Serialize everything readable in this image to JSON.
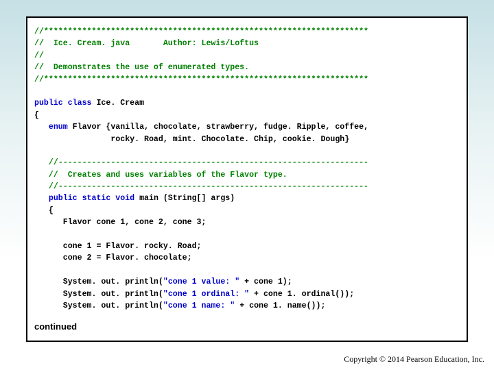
{
  "hdr": {
    "stars1": "//********************************************************************",
    "file": "//  Ice. Cream. java       Author: Lewis/Loftus",
    "blank": "//",
    "desc": "//  Demonstrates the use of enumerated types.",
    "stars2": "//********************************************************************"
  },
  "decl": {
    "kw1": "public class",
    "cls": " Ice. Cream",
    "ob": "{",
    "enum_kw": "enum",
    "enum_rest": " Flavor {vanilla, chocolate, strawberry, fudge. Ripple, coffee,",
    "enum_l2": "                rocky. Road, mint. Chocolate. Chip, cookie. Dough}"
  },
  "inner": {
    "c1": "   //-----------------------------------------------------------------",
    "c2": "   //  Creates and uses variables of the Flavor type.",
    "c3": "   //-----------------------------------------------------------------",
    "m_kw": "public static void",
    "m_rest": " main (String[] args)",
    "ob": "   {",
    "v1": "      Flavor cone 1, cone 2, cone 3;",
    "a1": "      cone 1 = Flavor. rocky. Road;",
    "a2": "      cone 2 = Flavor. chocolate;",
    "p1a": "      System. out. println(",
    "p1s": "\"cone 1 value: \"",
    "p1b": " + cone 1);",
    "p2a": "      System. out. println(",
    "p2s": "\"cone 1 ordinal: \"",
    "p2b": " + cone 1. ordinal());",
    "p3a": "      System. out. println(",
    "p3s": "\"cone 1 name: \"",
    "p3b": " + cone 1. name());"
  },
  "continued": "continued",
  "copyright": "Copyright © 2014 Pearson Education, Inc."
}
